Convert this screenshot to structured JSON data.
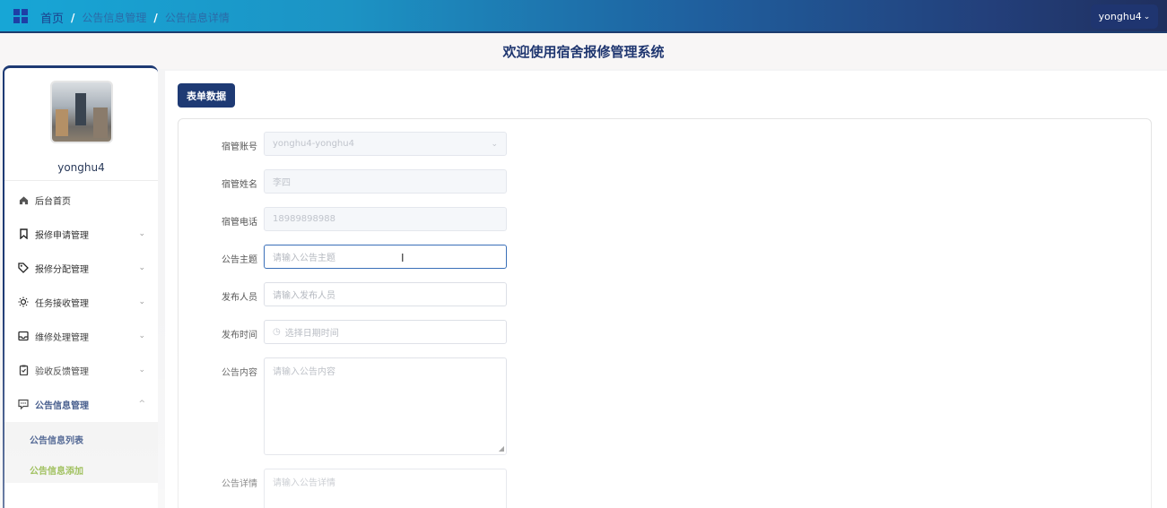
{
  "header": {
    "breadcrumb": [
      "首页",
      "公告信息管理",
      "公告信息详情"
    ],
    "separator": "/",
    "user_label": "yonghu4",
    "user_caret": "⌄"
  },
  "welcome": "欢迎使用宿舍报修管理系统",
  "sidebar": {
    "username": "yonghu4",
    "items": [
      {
        "label": "后台首页",
        "icon": "home-icon"
      },
      {
        "label": "报修申请管理",
        "icon": "bookmark-icon"
      },
      {
        "label": "报修分配管理",
        "icon": "tag-icon"
      },
      {
        "label": "任务接收管理",
        "icon": "sun-icon"
      },
      {
        "label": "维修处理管理",
        "icon": "inbox-icon"
      },
      {
        "label": "验收反馈管理",
        "icon": "clipboard-icon"
      },
      {
        "label": "公告信息管理",
        "icon": "message-icon"
      }
    ],
    "sub_items": [
      "公告信息列表",
      "公告信息添加"
    ],
    "colors": {
      "active_sub": "#7aa81e",
      "primary": "#1e3a74"
    }
  },
  "main": {
    "tab_label": "表单数据",
    "fields": [
      {
        "label": "宿管账号",
        "value": "yonghu4-yonghu4",
        "placeholder": ""
      },
      {
        "label": "宿管姓名",
        "value": "李四",
        "placeholder": ""
      },
      {
        "label": "宿管电话",
        "value": "18989898988",
        "placeholder": ""
      },
      {
        "label": "公告主题",
        "value": "",
        "placeholder": "请输入公告主题"
      },
      {
        "label": "发布人员",
        "value": "",
        "placeholder": "请输入发布人员"
      },
      {
        "label": "发布时间",
        "value": "",
        "placeholder": "选择日期时间"
      },
      {
        "label": "公告内容",
        "value": "",
        "placeholder": "请输入公告内容"
      },
      {
        "label": "公告详情",
        "value": "",
        "placeholder": "请输入公告详情"
      }
    ]
  }
}
